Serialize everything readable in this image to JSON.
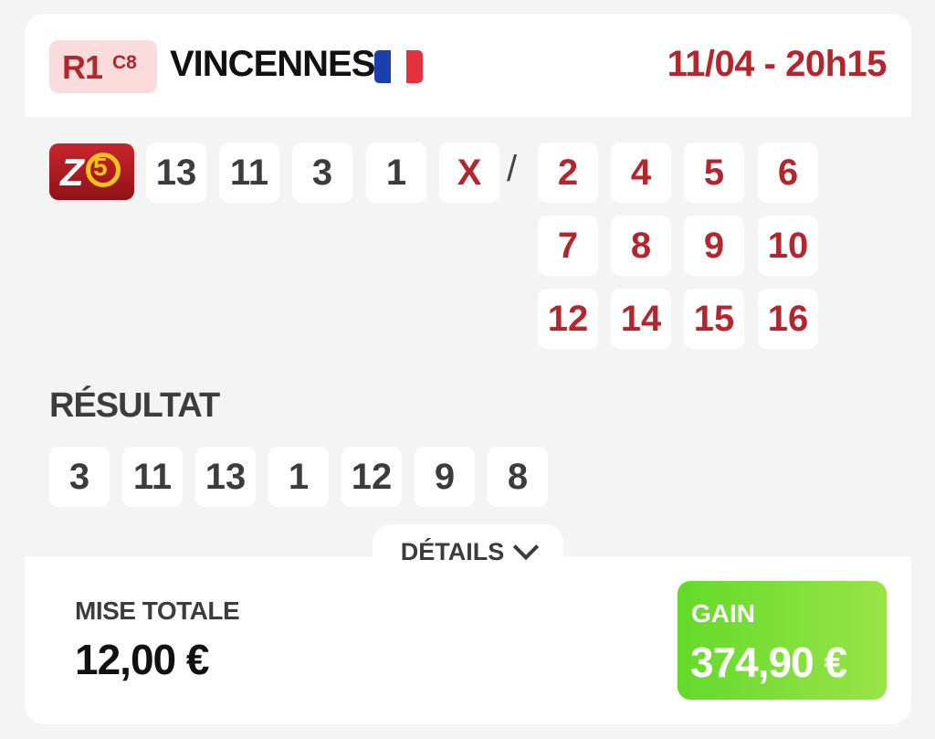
{
  "race": {
    "reunion": "R1",
    "course": "C8",
    "venue": "VINCENNES",
    "datetime": "11/04 - 20h15"
  },
  "flag": {
    "colors": [
      "#1d3fae",
      "#ffffff",
      "#e5303e"
    ]
  },
  "bet": {
    "type_icon": "z5-logo-icon",
    "type_icon_text": {
      "z": "Z",
      "five": "5"
    },
    "base": [
      "13",
      "11",
      "3",
      "1"
    ],
    "base_marker": "X",
    "separator": "/",
    "associates": [
      "2",
      "4",
      "5",
      "6",
      "7",
      "8",
      "9",
      "10",
      "12",
      "14",
      "15",
      "16"
    ]
  },
  "result": {
    "label": "RÉSULTAT",
    "numbers": [
      "3",
      "11",
      "13",
      "1",
      "12",
      "9",
      "8"
    ]
  },
  "details": {
    "label": "DÉTAILS",
    "icon": "chevron-down-icon"
  },
  "footer": {
    "stake_label": "MISE TOTALE",
    "stake_value": "12,00 €",
    "gain_label": "GAIN",
    "gain_value": "374,90 €"
  },
  "colors": {
    "accent_red": "#b3262e",
    "badge_bg": "#fbdcdc",
    "gain_green": "#64da2a"
  }
}
